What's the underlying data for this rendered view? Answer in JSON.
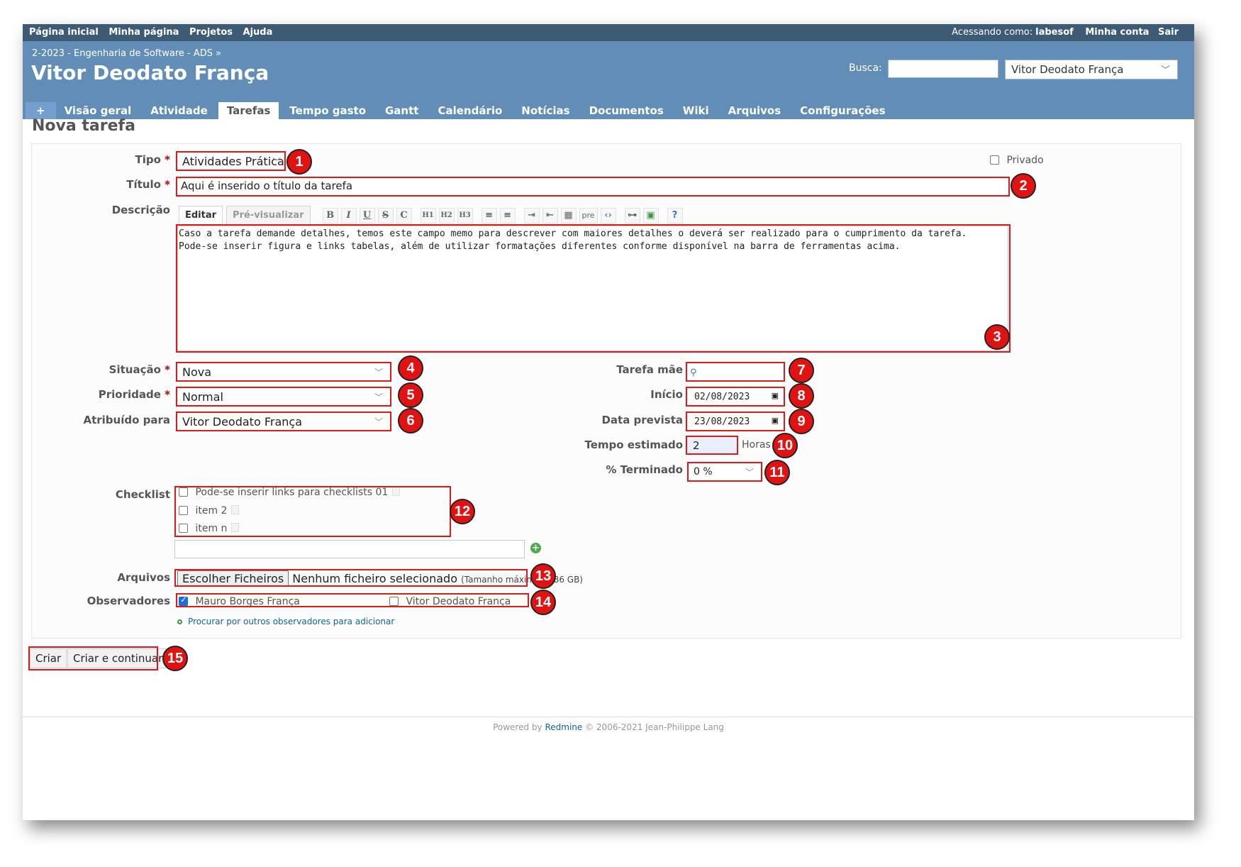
{
  "topmenu": {
    "left": [
      "Página inicial",
      "Minha página",
      "Projetos",
      "Ajuda"
    ],
    "logged_as_label": "Acessando como:",
    "user": "labesof",
    "my_account": "Minha conta",
    "logout": "Sair"
  },
  "header": {
    "breadcrumb": "2-2023 - Engenharia de Software - ADS »",
    "title": "Vitor Deodato França",
    "search_label": "Busca:",
    "search_value": "",
    "project_select": "Vitor Deodato França"
  },
  "tabs": [
    "+",
    "Visão geral",
    "Atividade",
    "Tarefas",
    "Tempo gasto",
    "Gantt",
    "Calendário",
    "Notícias",
    "Documentos",
    "Wiki",
    "Arquivos",
    "Configurações"
  ],
  "page_title": "Nova tarefa",
  "form": {
    "tipo_label": "Tipo",
    "tipo_value": "Atividades Práticas",
    "privado_label": "Privado",
    "titulo_label": "Título",
    "titulo_value": "Aqui é inserido o título da tarefa",
    "descricao_label": "Descrição",
    "editor_tab_edit": "Editar",
    "editor_tab_preview": "Pré-visualizar",
    "toolbar": [
      "B",
      "I",
      "U",
      "S",
      "C",
      "H1",
      "H2",
      "H3",
      "ul",
      "ol",
      "indent-right",
      "indent-left",
      "table",
      "pre",
      "code",
      "link",
      "image",
      "help"
    ],
    "descricao_lines": [
      "Caso a tarefa demande detalhes, temos este campo memo para descrever com maiores detalhes o deverá ser realizado para o cumprimento da tarefa.",
      "Pode-se inserir figura e links tabelas, além de utilizar formatações diferentes conforme disponível na barra de ferramentas acima."
    ],
    "situacao_label": "Situação",
    "situacao_value": "Nova",
    "prioridade_label": "Prioridade",
    "prioridade_value": "Normal",
    "atribuido_label": "Atribuído para",
    "atribuido_value": "Vitor Deodato França",
    "tarefa_mae_label": "Tarefa mãe",
    "inicio_label": "Início",
    "inicio_value": "02/08/2023",
    "data_prevista_label": "Data prevista",
    "data_prevista_value": "23/08/2023",
    "tempo_estimado_label": "Tempo estimado",
    "tempo_estimado_value": "2",
    "horas_label": "Horas",
    "terminado_label": "% Terminado",
    "terminado_value": "0 %",
    "checklist_label": "Checklist",
    "checklist_items": [
      "Pode-se inserir links para checklists 01",
      "item 2",
      "item n"
    ],
    "arquivos_label": "Arquivos",
    "file_button": "Escolher Ficheiros",
    "file_status": "Nenhum ficheiro selecionado",
    "file_max": "(Tamanho máximo: 2,86 GB)",
    "observadores_label": "Observadores",
    "watchers": [
      {
        "name": "Mauro Borges França",
        "checked": true
      },
      {
        "name": "Vitor Deodato França",
        "checked": false
      }
    ],
    "add_watchers_link": "Procurar por outros observadores para adicionar"
  },
  "buttons": {
    "create": "Criar",
    "create_continue": "Criar e continuar"
  },
  "badges": [
    "1",
    "2",
    "3",
    "4",
    "5",
    "6",
    "7",
    "8",
    "9",
    "10",
    "11",
    "12",
    "13",
    "14",
    "15"
  ],
  "footer": {
    "prefix": "Powered by",
    "link": "Redmine",
    "suffix": "© 2006-2021 Jean-Philippe Lang"
  },
  "colors": {
    "top_menu": "#3e5b76",
    "header": "#628db6",
    "annotation": "#e31212"
  }
}
